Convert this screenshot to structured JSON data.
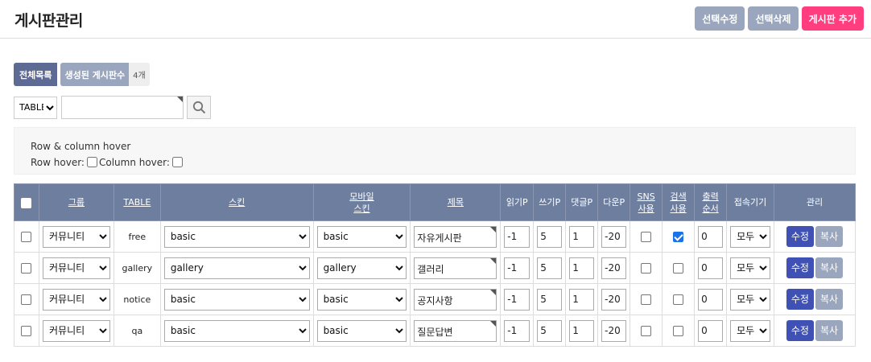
{
  "header": {
    "title": "게시판관리",
    "btn_edit": "선택수정",
    "btn_delete": "선택삭제",
    "btn_add": "게시판 추가",
    "colors": {
      "gray": "#9aa6bd",
      "pink": "#ff3d7f"
    }
  },
  "tabs": {
    "all": "전체목록",
    "count_label": "생성된 게시판수",
    "count": "4개"
  },
  "search": {
    "field_selected": "TABLE",
    "input_value": "",
    "icon": "search-icon"
  },
  "hover": {
    "title": "Row & column hover",
    "row_label": "Row hover:",
    "col_label": "Column hover:"
  },
  "table": {
    "headers": {
      "group": "그룹",
      "table": "TABLE",
      "skin": "스킨",
      "mobile_skin_1": "모바일",
      "mobile_skin_2": "스킨",
      "subject": "제목",
      "read": "읽기P",
      "write": "쓰기P",
      "comment": "댓글P",
      "download": "다운P",
      "sns_1": "SNS",
      "sns_2": "사용",
      "search_1": "검색",
      "search_2": "사용",
      "order_1": "출력",
      "order_2": "순서",
      "device": "접속기기",
      "manage": "관리"
    },
    "rows": [
      {
        "group": "커뮤니티",
        "table": "free",
        "skin": "basic",
        "mobile_skin": "basic",
        "subject": "자유게시판",
        "read": "-1",
        "write": "5",
        "comment": "1",
        "download": "-20",
        "sns": false,
        "search": true,
        "order": "0",
        "device": "모두",
        "edit": "수정",
        "copy": "복사"
      },
      {
        "group": "커뮤니티",
        "table": "gallery",
        "skin": "gallery",
        "mobile_skin": "gallery",
        "subject": "갤러리",
        "read": "-1",
        "write": "5",
        "comment": "1",
        "download": "-20",
        "sns": false,
        "search": false,
        "order": "0",
        "device": "모두",
        "edit": "수정",
        "copy": "복사"
      },
      {
        "group": "커뮤니티",
        "table": "notice",
        "skin": "basic",
        "mobile_skin": "basic",
        "subject": "공지사항",
        "read": "-1",
        "write": "5",
        "comment": "1",
        "download": "-20",
        "sns": false,
        "search": false,
        "order": "0",
        "device": "모두",
        "edit": "수정",
        "copy": "복사"
      },
      {
        "group": "커뮤니티",
        "table": "qa",
        "skin": "basic",
        "mobile_skin": "basic",
        "subject": "질문답변",
        "read": "-1",
        "write": "5",
        "comment": "1",
        "download": "-20",
        "sns": false,
        "search": false,
        "order": "0",
        "device": "모두",
        "edit": "수정",
        "copy": "복사"
      }
    ]
  }
}
